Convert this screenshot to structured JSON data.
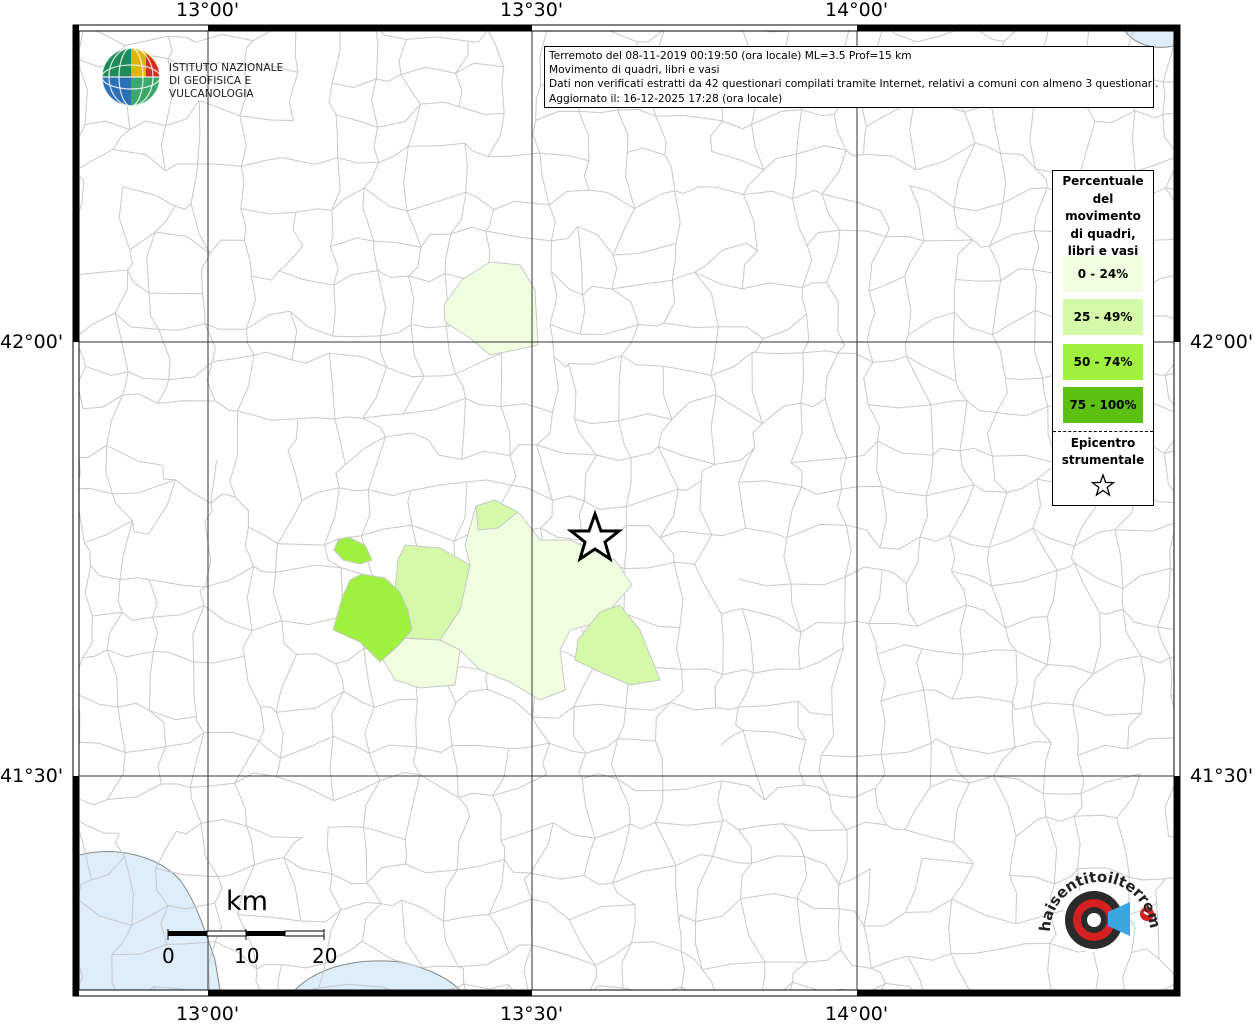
{
  "map": {
    "longitude_labels": [
      "13°00'",
      "13°30'",
      "14°00'"
    ],
    "latitude_labels": [
      "42°00'",
      "41°30'"
    ]
  },
  "info": {
    "line1": "Terremoto del 08-11-2019 00:19:50 (ora locale) ML=3.5 Prof=15 km",
    "line2": "Movimento di quadri, libri e vasi",
    "line3": "Dati non verificati estratti da 42 questionari compilati tramite Internet, relativi a comuni con almeno 3 questionari.",
    "line4": "Aggiornato il: 16-12-2025 17:28 (ora locale)"
  },
  "legend": {
    "title": [
      "Percentuale",
      "del",
      "movimento",
      "di quadri,",
      "libri e vasi"
    ],
    "items": [
      {
        "label": "0 - 24%",
        "color": "#f0ffe0"
      },
      {
        "label": "25 - 49%",
        "color": "#d4f9a8"
      },
      {
        "label": "50 - 74%",
        "color": "#a0f040"
      },
      {
        "label": "75 - 100%",
        "color": "#5cc010"
      }
    ],
    "epicenter_label": [
      "Epicentro",
      "strumentale"
    ],
    "epicenter_icon": "star-icon"
  },
  "logo": {
    "line1": "ISTITUTO NAZIONALE",
    "line2": "DI GEOFISICA E VULCANOLOGIA"
  },
  "scale": {
    "unit": "km",
    "ticks": [
      "0",
      "10",
      "20"
    ]
  },
  "watermark": {
    "text": "haisentitoilterremoto.it www."
  },
  "colors": {
    "sea": "#ddeefa",
    "boundary": "#c8c8c8",
    "grid": "#333333"
  }
}
